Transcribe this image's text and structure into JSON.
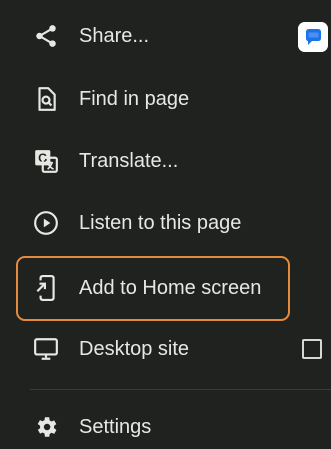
{
  "menu": {
    "items": [
      {
        "label": "Share...",
        "icon": "share-icon"
      },
      {
        "label": "Find in page",
        "icon": "find-in-page-icon"
      },
      {
        "label": "Translate...",
        "icon": "translate-icon"
      },
      {
        "label": "Listen to this page",
        "icon": "play-circle-icon"
      },
      {
        "label": "Add to Home screen",
        "icon": "add-to-home-screen-icon"
      },
      {
        "label": "Desktop site",
        "icon": "desktop-icon",
        "checkbox_checked": false
      },
      {
        "label": "Settings",
        "icon": "gear-icon"
      }
    ],
    "share_target_icon": "messages-app-icon",
    "highlight_color": "#e58a3c",
    "background_color": "#1f221f"
  }
}
